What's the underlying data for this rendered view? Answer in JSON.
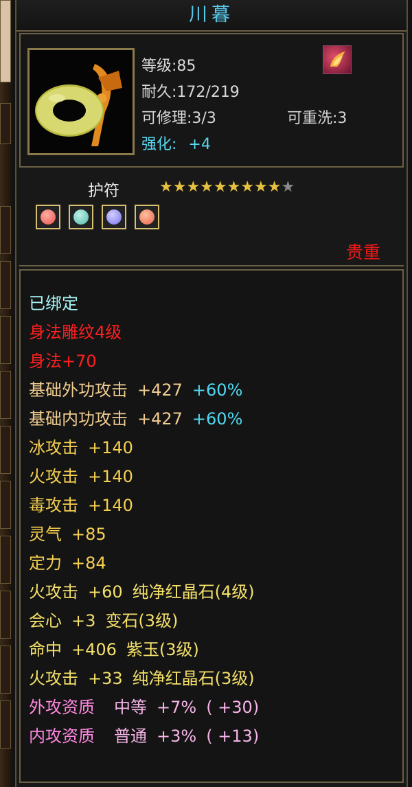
{
  "item": {
    "name": "川暮",
    "level": "等级:85",
    "durability": "耐久:172/219",
    "repairable": "可修理:3/3",
    "rewash": "可重洗:3",
    "enhance_label": "强化:",
    "enhance_value": "+4",
    "type_label": "护符",
    "stars_filled": 9,
    "stars_total": 10,
    "star_filled_glyph": "★★★★★★★★★",
    "star_empty_glyph": "★",
    "rarity": "贵重",
    "icons": [
      "jade-pendant-icon",
      "fire-gem-icon"
    ]
  },
  "sockets": [
    {
      "name": "red-crystal-socket",
      "color": "#e85050"
    },
    {
      "name": "cyan-gem-socket",
      "color": "#50b8a8"
    },
    {
      "name": "purple-jade-socket",
      "color": "#7a70e8"
    },
    {
      "name": "red-crystal-socket",
      "color": "#e86048"
    }
  ],
  "attributes": {
    "bound": "已绑定",
    "engraving": "身法雕纹4级",
    "agility": "身法+70",
    "ext_attack": {
      "label": "基础外功攻击",
      "value": "+427",
      "pct": "+60%"
    },
    "int_attack": {
      "label": "基础内功攻击",
      "value": "+427",
      "pct": "+60%"
    },
    "ice": {
      "label": "冰攻击",
      "value": "+140"
    },
    "fire": {
      "label": "火攻击",
      "value": "+140"
    },
    "poison": {
      "label": "毒攻击",
      "value": "+140"
    },
    "spirit": {
      "label": "灵气",
      "value": "+85"
    },
    "focus": {
      "label": "定力",
      "value": "+84"
    },
    "gem1": {
      "label": "火攻击",
      "value": "+60",
      "gem": "纯净红晶石(4级)"
    },
    "gem2": {
      "label": "会心",
      "value": "+3",
      "gem": "变石(3级)"
    },
    "gem3": {
      "label": "命中",
      "value": "+406",
      "gem": "紫玉(3级)"
    },
    "gem4": {
      "label": "火攻击",
      "value": "+33",
      "gem": "纯净红晶石(3级)"
    },
    "q1": {
      "label": "外攻资质",
      "grade": "中等",
      "pct": "+7%",
      "extra": "( +30)"
    },
    "q2": {
      "label": "内攻资质",
      "grade": "普通",
      "pct": "+3%",
      "extra": "( +13)"
    }
  },
  "colors": {
    "title": "#58c8ea",
    "bound": "#a8f4f4",
    "engraving": "#ff2020",
    "base_attack": "#f0cc90",
    "element_attack": "#f6d050",
    "percent": "#50d8f0",
    "gem_line": "#f4e06a",
    "quality": "#ff88e0",
    "rarity": "#f01818"
  }
}
